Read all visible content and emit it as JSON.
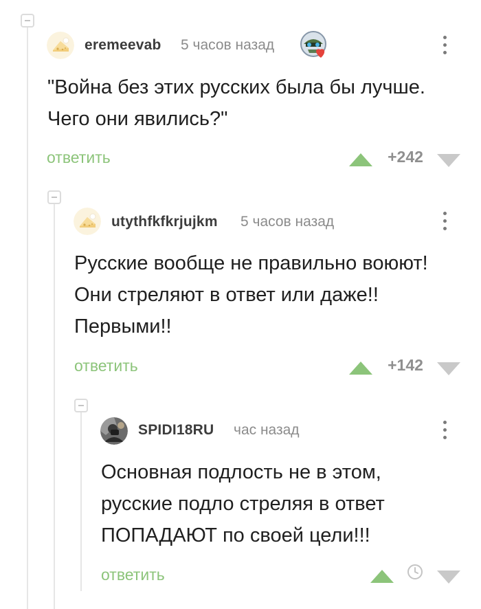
{
  "comments": [
    {
      "username": "eremeevab",
      "time": "5 часов назад",
      "text_lines": [
        "\"Война без этих русских была бы лучше.",
        "Чего они явились?\""
      ],
      "reply_label": "ответить",
      "rating": "+242",
      "avatar_icon": "cheese-avatar-icon",
      "badge_icon": "award-badge-heart-icon"
    },
    {
      "username": "utythfkfkrjujkm",
      "time": "5 часов назад",
      "text_lines": [
        "Русские вообще не правильно воюют!",
        "Они стреляют в ответ или даже!!",
        "Первыми!!"
      ],
      "reply_label": "ответить",
      "rating": "+142",
      "avatar_icon": "cheese-avatar-icon"
    },
    {
      "username": "SPIDI18RU",
      "time": "час назад",
      "text_lines": [
        "Основная подлость не в этом,",
        "русские подло стреляя в ответ",
        "ПОПАДАЮТ по своей цели!!!"
      ],
      "reply_label": "ответить",
      "avatar_icon": "photo-avatar-icon",
      "rating_icon": "clock-icon"
    }
  ],
  "colors": {
    "accent_green": "#8cc47a",
    "username": "#3c3c3c",
    "muted": "#8b8b8b",
    "thread_line": "#e6e6e6"
  }
}
